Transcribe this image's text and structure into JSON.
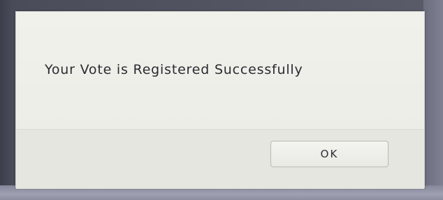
{
  "dialog": {
    "message": "Your Vote is Registered Successfully",
    "ok_label": "OK"
  },
  "colors": {
    "dialog_background": "#ecece6",
    "text": "#2a2b30"
  }
}
